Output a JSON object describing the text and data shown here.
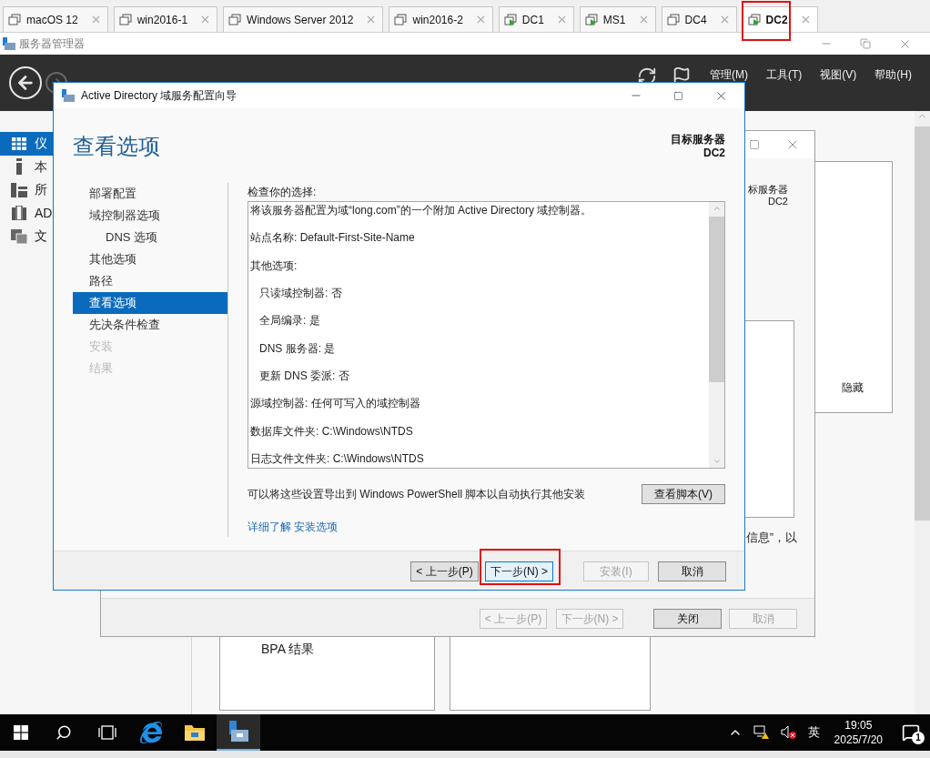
{
  "vm_tabs": [
    {
      "label": "macOS 12",
      "running": false,
      "selected": false,
      "highlighted": false
    },
    {
      "label": "win2016-1",
      "running": false,
      "selected": false,
      "highlighted": false
    },
    {
      "label": "Windows Server 2012",
      "running": false,
      "selected": false,
      "highlighted": false
    },
    {
      "label": "win2016-2",
      "running": false,
      "selected": false,
      "highlighted": false
    },
    {
      "label": "DC1",
      "running": true,
      "selected": false,
      "highlighted": false
    },
    {
      "label": "MS1",
      "running": true,
      "selected": false,
      "highlighted": false
    },
    {
      "label": "DC4",
      "running": false,
      "selected": false,
      "highlighted": false
    },
    {
      "label": "DC2",
      "running": true,
      "selected": true,
      "highlighted": true
    }
  ],
  "server_manager": {
    "title": "服务器管理器",
    "menu": [
      "管理(M)",
      "工具(T)",
      "视图(V)",
      "帮助(H)"
    ],
    "sidebar": [
      {
        "label": "仪",
        "kind": "dashboard",
        "selected": true
      },
      {
        "label": "本",
        "kind": "local",
        "selected": false
      },
      {
        "label": "所",
        "kind": "all",
        "selected": false
      },
      {
        "label": "AD",
        "kind": "adds",
        "selected": false
      },
      {
        "label": "文",
        "kind": "files",
        "selected": false
      }
    ],
    "dashboard": {
      "hide_link": "隐藏",
      "tile_label": "BPA 结果"
    }
  },
  "back_wizard": {
    "target_label": "标服务器",
    "target_server": "DC2",
    "note": "信息”，以",
    "buttons": [
      {
        "label": "< 上一步(P)",
        "disabled": true
      },
      {
        "label": "下一步(N) >",
        "disabled": true
      },
      {
        "label": "关闭",
        "disabled": false
      },
      {
        "label": "取消",
        "disabled": true
      }
    ]
  },
  "dialog": {
    "title": "Active Directory 域服务配置向导",
    "heading": "查看选项",
    "target_label": "目标服务器",
    "target_server": "DC2",
    "nav": [
      {
        "label": "部署配置",
        "selected": false,
        "disabled": false
      },
      {
        "label": "域控制器选项",
        "selected": false,
        "disabled": false,
        "children": [
          {
            "label": "DNS 选项",
            "selected": false,
            "disabled": false
          }
        ]
      },
      {
        "label": "其他选项",
        "selected": false,
        "disabled": false
      },
      {
        "label": "路径",
        "selected": false,
        "disabled": false
      },
      {
        "label": "查看选项",
        "selected": true,
        "disabled": false
      },
      {
        "label": "先决条件检查",
        "selected": false,
        "disabled": false
      },
      {
        "label": "安装",
        "selected": false,
        "disabled": true
      },
      {
        "label": "结果",
        "selected": false,
        "disabled": true
      }
    ],
    "review_label": "检查你的选择:",
    "summary": [
      {
        "text": "将该服务器配置为域“long.com”的一个附加 Active Directory 域控制器。"
      },
      {
        "text": "站点名称: Default-First-Site-Name"
      },
      {
        "text": "其他选项:",
        "children": [
          {
            "text": "只读域控制器: 否"
          },
          {
            "text": "全局编录: 是"
          },
          {
            "text": "DNS 服务器: 是"
          },
          {
            "text": "更新 DNS 委派: 否"
          }
        ]
      },
      {
        "text": "源域控制器: 任何可写入的域控制器"
      },
      {
        "text": "数据库文件夹: C:\\Windows\\NTDS"
      },
      {
        "text": "日志文件文件夹: C:\\Windows\\NTDS"
      }
    ],
    "export_text": "可以将这些设置导出到 Windows PowerShell 脚本以自动执行其他安装",
    "view_script_button": "查看脚本(V)",
    "learn_more_link": "详细了解 安装选项",
    "buttons": [
      {
        "label": "< 上一步(P)",
        "disabled": false,
        "focused": false,
        "highlighted": false
      },
      {
        "label": "下一步(N) >",
        "disabled": false,
        "focused": true,
        "highlighted": true
      },
      {
        "label": "安装(I)",
        "disabled": true,
        "focused": false,
        "highlighted": false
      },
      {
        "label": "取消",
        "disabled": false,
        "focused": false,
        "highlighted": false
      }
    ]
  },
  "taskbar": {
    "apps": [
      {
        "kind": "search",
        "active": false
      },
      {
        "kind": "task-view",
        "active": false
      },
      {
        "kind": "browser",
        "active": false
      },
      {
        "kind": "folder",
        "active": false
      },
      {
        "kind": "server-manager",
        "active": true
      }
    ],
    "ime": "英",
    "time": "19:05",
    "date": "2025/7/20",
    "notifications": "1"
  }
}
